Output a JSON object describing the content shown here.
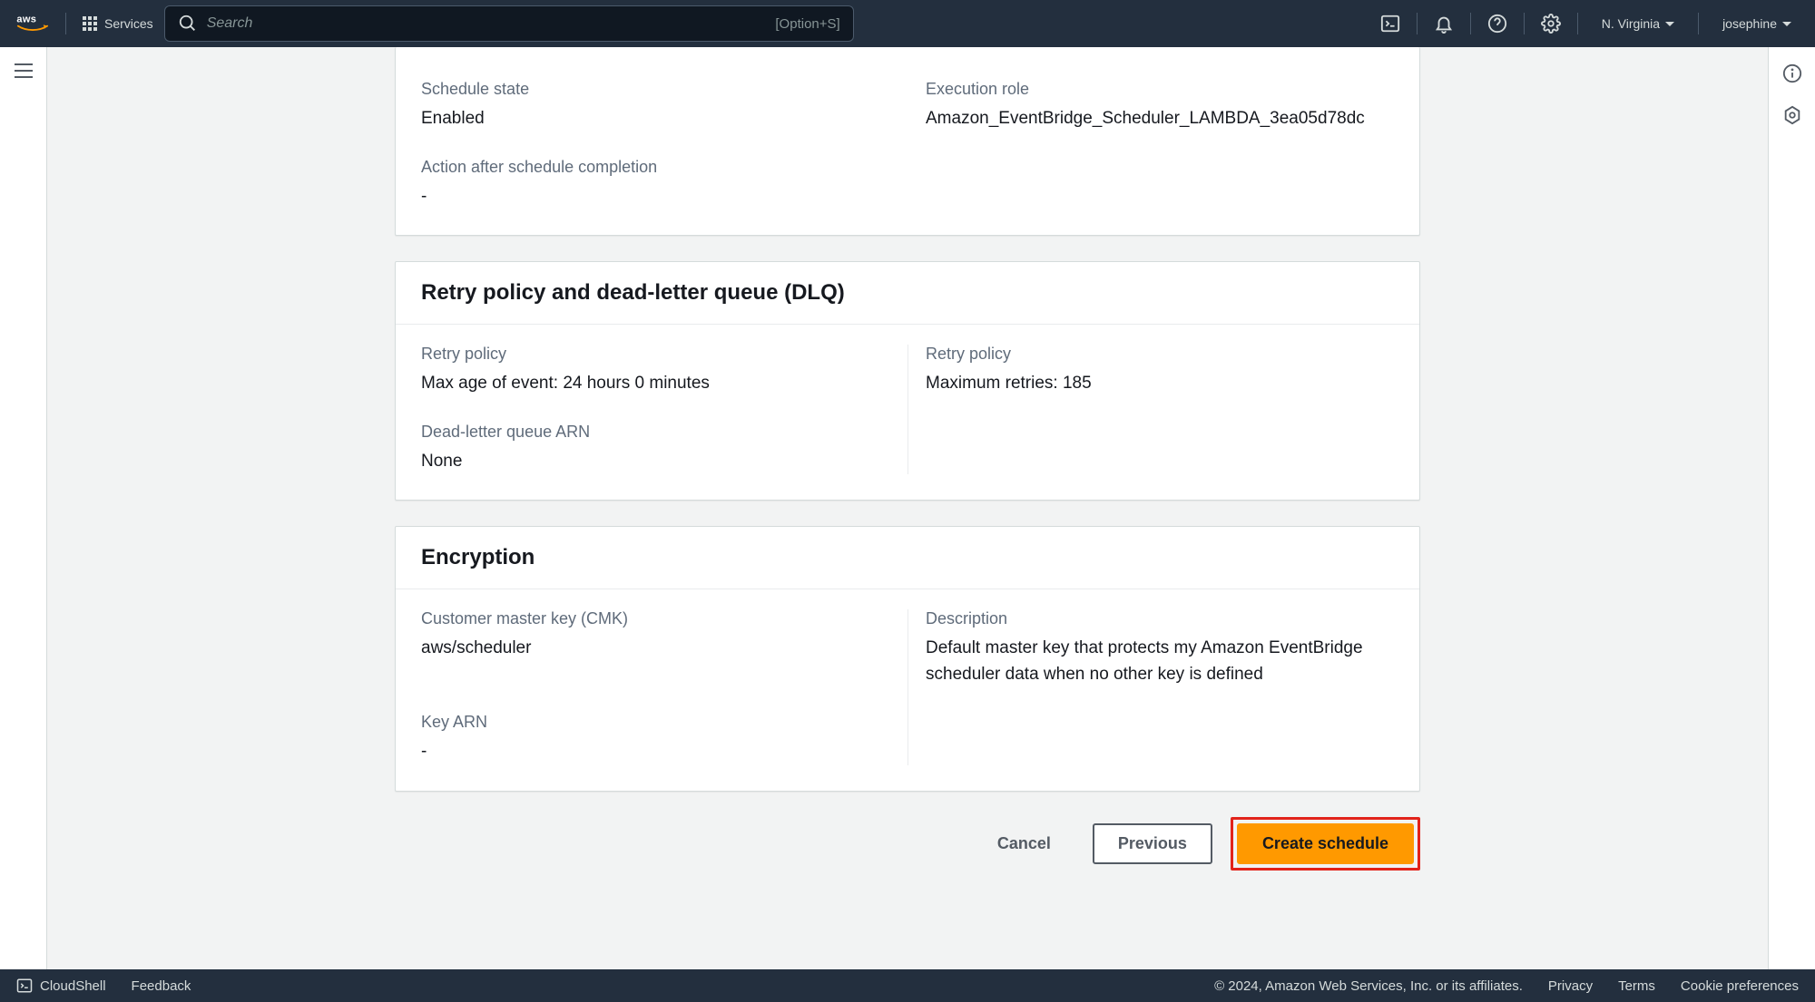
{
  "nav": {
    "services": "Services",
    "search_placeholder": "Search",
    "shortcut": "[Option+S]",
    "region": "N. Virginia",
    "user": "josephine"
  },
  "panels": {
    "summary": {
      "schedule_state_label": "Schedule state",
      "schedule_state_value": "Enabled",
      "execution_role_label": "Execution role",
      "execution_role_value": "Amazon_EventBridge_Scheduler_LAMBDA_3ea05d78dc",
      "action_after_label": "Action after schedule completion",
      "action_after_value": "-"
    },
    "retry": {
      "title": "Retry policy and dead-letter queue (DLQ)",
      "retry_policy_label_left": "Retry policy",
      "max_age_value": "Max age of event: 24 hours 0 minutes",
      "retry_policy_label_right": "Retry policy",
      "max_retries_value": "Maximum retries: 185",
      "dlq_label": "Dead-letter queue ARN",
      "dlq_value": "None"
    },
    "encryption": {
      "title": "Encryption",
      "cmk_label": "Customer master key (CMK)",
      "cmk_value": "aws/scheduler",
      "description_label": "Description",
      "description_value": "Default master key that protects my Amazon EventBridge scheduler data when no other key is defined",
      "key_arn_label": "Key ARN",
      "key_arn_value": "-"
    }
  },
  "actions": {
    "cancel": "Cancel",
    "previous": "Previous",
    "create": "Create schedule"
  },
  "footer": {
    "cloudshell": "CloudShell",
    "feedback": "Feedback",
    "copyright": "© 2024, Amazon Web Services, Inc. or its affiliates.",
    "privacy": "Privacy",
    "terms": "Terms",
    "cookies": "Cookie preferences"
  }
}
